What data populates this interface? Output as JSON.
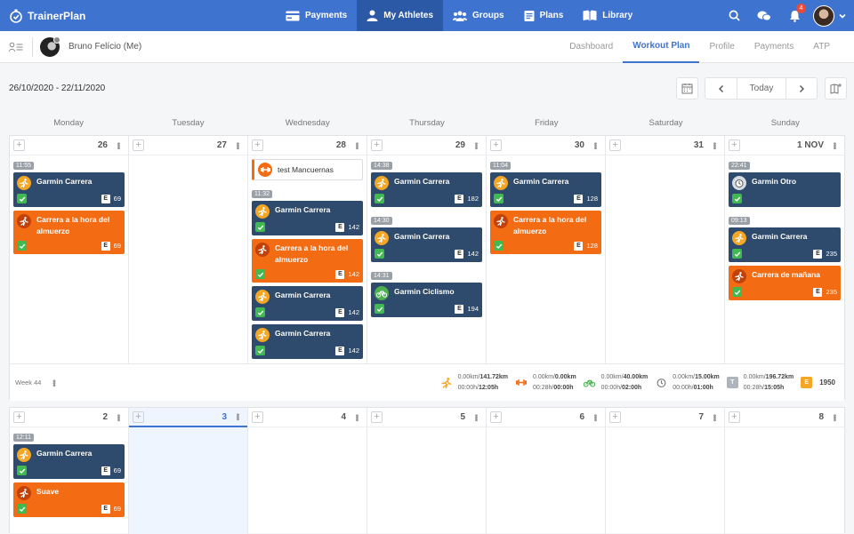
{
  "app": {
    "name": "TrainerPlan"
  },
  "nav": [
    {
      "label": "Payments",
      "icon": "payments-icon"
    },
    {
      "label": "My Athletes",
      "icon": "user-icon",
      "active": true
    },
    {
      "label": "Groups",
      "icon": "groups-icon"
    },
    {
      "label": "Plans",
      "icon": "plans-icon"
    },
    {
      "label": "Library",
      "icon": "library-icon"
    }
  ],
  "notifications": {
    "count": "4"
  },
  "athlete": {
    "name": "Bruno Felício (Me)"
  },
  "subtabs": [
    {
      "label": "Dashboard"
    },
    {
      "label": "Workout Plan",
      "active": true
    },
    {
      "label": "Profile"
    },
    {
      "label": "Payments"
    },
    {
      "label": "ATP"
    }
  ],
  "toolbar": {
    "date_range": "26/10/2020 - 22/11/2020",
    "today_label": "Today"
  },
  "day_names": [
    "Monday",
    "Tuesday",
    "Wednesday",
    "Thursday",
    "Friday",
    "Saturday",
    "Sunday"
  ],
  "weeks": [
    {
      "days": [
        {
          "num": "26",
          "items": [
            {
              "time": "11:55",
              "title": "Garmin Carrera",
              "color": "blue",
              "icon": "run",
              "value": "69"
            },
            {
              "title": "Carrera a la hora del almuerzo",
              "color": "orange",
              "icon": "runo",
              "value": "69"
            }
          ]
        },
        {
          "num": "27",
          "items": []
        },
        {
          "num": "28",
          "items": [
            {
              "title": "test Mancuernas",
              "color": "white",
              "icon": "gym"
            },
            {
              "time": "11:32",
              "title": "Garmin Carrera",
              "color": "blue",
              "icon": "run",
              "value": "142"
            },
            {
              "title": "Carrera a la hora del almuerzo",
              "color": "orange",
              "icon": "runo",
              "value": "142"
            },
            {
              "title": "Garmin Carrera",
              "color": "blue",
              "icon": "run",
              "value": "142"
            },
            {
              "title": "Garmin Carrera",
              "color": "blue",
              "icon": "run",
              "value": "142"
            }
          ]
        },
        {
          "num": "29",
          "items": [
            {
              "time": "14:38",
              "title": "Garmin Carrera",
              "color": "blue",
              "icon": "run",
              "value": "182"
            },
            {
              "time": "14:30",
              "title": "Garmin Carrera",
              "color": "blue",
              "icon": "run",
              "value": "142"
            },
            {
              "time": "14:31",
              "title": "Garmin Ciclismo",
              "color": "blue",
              "icon": "cyc",
              "value": "194"
            }
          ]
        },
        {
          "num": "30",
          "items": [
            {
              "time": "11:04",
              "title": "Garmin Carrera",
              "color": "blue",
              "icon": "run",
              "value": "128"
            },
            {
              "title": "Carrera a la hora del almuerzo",
              "color": "orange",
              "icon": "runo",
              "value": "128"
            }
          ]
        },
        {
          "num": "31",
          "items": []
        },
        {
          "num": "1 NOV",
          "items": [
            {
              "time": "22:41",
              "title": "Garmin Otro",
              "color": "blue",
              "icon": "oth",
              "value": ""
            },
            {
              "time": "09:13",
              "title": "Garmin Carrera",
              "color": "blue",
              "icon": "run",
              "value": "235"
            },
            {
              "title": "Carrera de mañana",
              "color": "orange",
              "icon": "runo",
              "value": "235"
            }
          ]
        }
      ],
      "summary": {
        "label": "Week 44",
        "stats": [
          {
            "icon": "run",
            "line1a": "0.00km/",
            "line1b": "141.72km",
            "line2a": "00:00h/",
            "line2b": "12:05h"
          },
          {
            "icon": "gym",
            "line1a": "0.00km/",
            "line1b": "0.00km",
            "line2a": "00:28h/",
            "line2b": "00:00h"
          },
          {
            "icon": "cyc",
            "line1a": "0.00km/",
            "line1b": "40.00km",
            "line2a": "00:00h/",
            "line2b": "02:00h"
          },
          {
            "icon": "oth",
            "line1a": "0.00km/",
            "line1b": "15.00km",
            "line2a": "00:00h/",
            "line2b": "01:00h"
          },
          {
            "icon": "T",
            "line1a": "0.00km/",
            "line1b": "196.72km",
            "line2a": "00:28h/",
            "line2b": "15:05h"
          }
        ],
        "total_letter": "E",
        "total": "1950"
      }
    },
    {
      "days": [
        {
          "num": "2",
          "items": [
            {
              "time": "12:11",
              "title": "Garmin Carrera",
              "color": "blue",
              "icon": "run",
              "value": "69"
            },
            {
              "title": "Suave",
              "color": "orange",
              "icon": "runo",
              "value": "69"
            }
          ]
        },
        {
          "num": "3",
          "today": true,
          "items": []
        },
        {
          "num": "4",
          "items": []
        },
        {
          "num": "5",
          "items": []
        },
        {
          "num": "6",
          "items": []
        },
        {
          "num": "7",
          "items": []
        },
        {
          "num": "8",
          "items": []
        }
      ]
    }
  ]
}
